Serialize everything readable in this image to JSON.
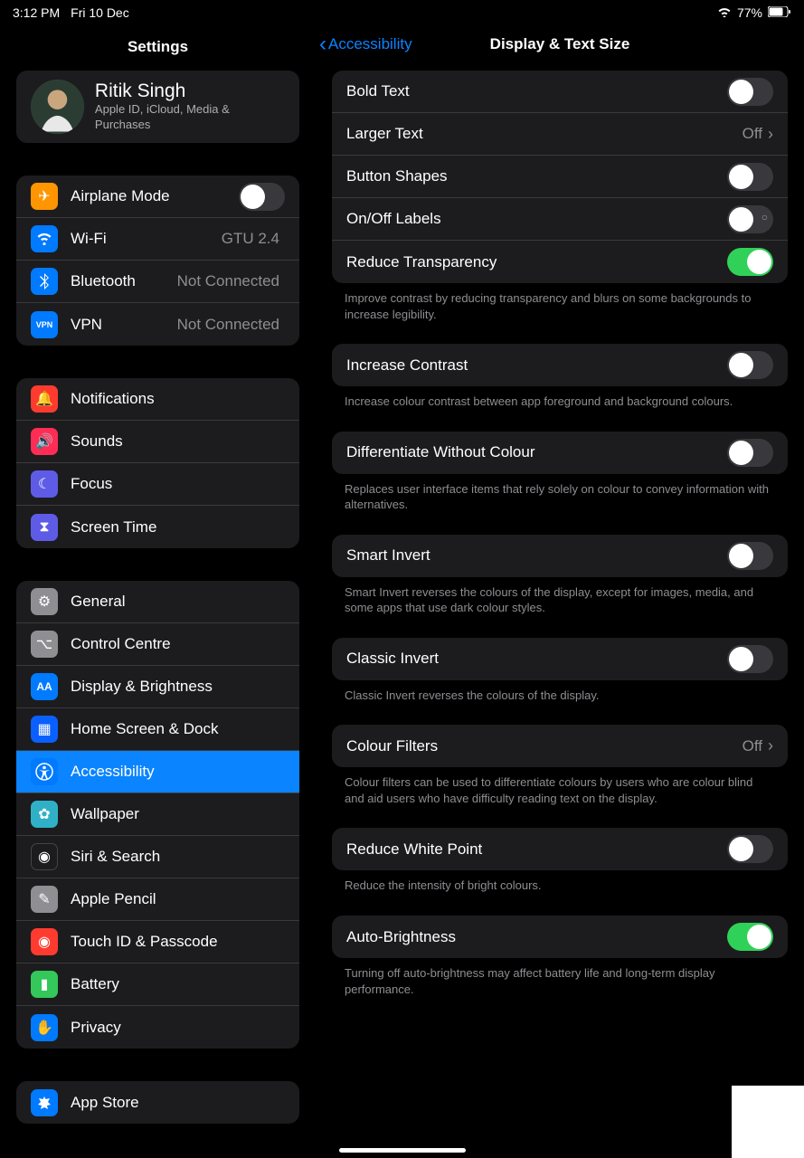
{
  "status": {
    "time": "3:12 PM",
    "date": "Fri 10 Dec",
    "battery": "77%"
  },
  "sidebar": {
    "title": "Settings",
    "profile": {
      "name": "Ritik Singh",
      "sub": "Apple ID, iCloud, Media & Purchases"
    },
    "g1": [
      {
        "label": "Airplane Mode"
      },
      {
        "label": "Wi-Fi",
        "value": "GTU 2.4"
      },
      {
        "label": "Bluetooth",
        "value": "Not Connected"
      },
      {
        "label": "VPN",
        "value": "Not Connected"
      }
    ],
    "g2": [
      {
        "label": "Notifications"
      },
      {
        "label": "Sounds"
      },
      {
        "label": "Focus"
      },
      {
        "label": "Screen Time"
      }
    ],
    "g3": [
      {
        "label": "General"
      },
      {
        "label": "Control Centre"
      },
      {
        "label": "Display & Brightness"
      },
      {
        "label": "Home Screen & Dock"
      },
      {
        "label": "Accessibility"
      },
      {
        "label": "Wallpaper"
      },
      {
        "label": "Siri & Search"
      },
      {
        "label": "Apple Pencil"
      },
      {
        "label": "Touch ID & Passcode"
      },
      {
        "label": "Battery"
      },
      {
        "label": "Privacy"
      }
    ],
    "g4": [
      {
        "label": "App Store"
      }
    ]
  },
  "detail": {
    "back": "Accessibility",
    "title": "Display & Text Size",
    "s1": {
      "bold": "Bold Text",
      "larger": "Larger Text",
      "larger_val": "Off",
      "shapes": "Button Shapes",
      "onoff": "On/Off Labels",
      "reduce_trans": "Reduce Transparency",
      "foot": "Improve contrast by reducing transparency and blurs on some backgrounds to increase legibility."
    },
    "s2": {
      "inc": "Increase Contrast",
      "foot": "Increase colour contrast between app foreground and background colours."
    },
    "s3": {
      "diff": "Differentiate Without Colour",
      "foot": "Replaces user interface items that rely solely on colour to convey information with alternatives."
    },
    "s4": {
      "smart": "Smart Invert",
      "foot": "Smart Invert reverses the colours of the display, except for images, media, and some apps that use dark colour styles."
    },
    "s5": {
      "classic": "Classic Invert",
      "foot": "Classic Invert reverses the colours of the display."
    },
    "s6": {
      "cf": "Colour Filters",
      "cf_val": "Off",
      "foot": "Colour filters can be used to differentiate colours by users who are colour blind and aid users who have difficulty reading text on the display."
    },
    "s7": {
      "rwp": "Reduce White Point",
      "foot": "Reduce the intensity of bright colours."
    },
    "s8": {
      "ab": "Auto-Brightness",
      "foot": "Turning off auto-brightness may affect battery life and long-term display performance."
    }
  }
}
